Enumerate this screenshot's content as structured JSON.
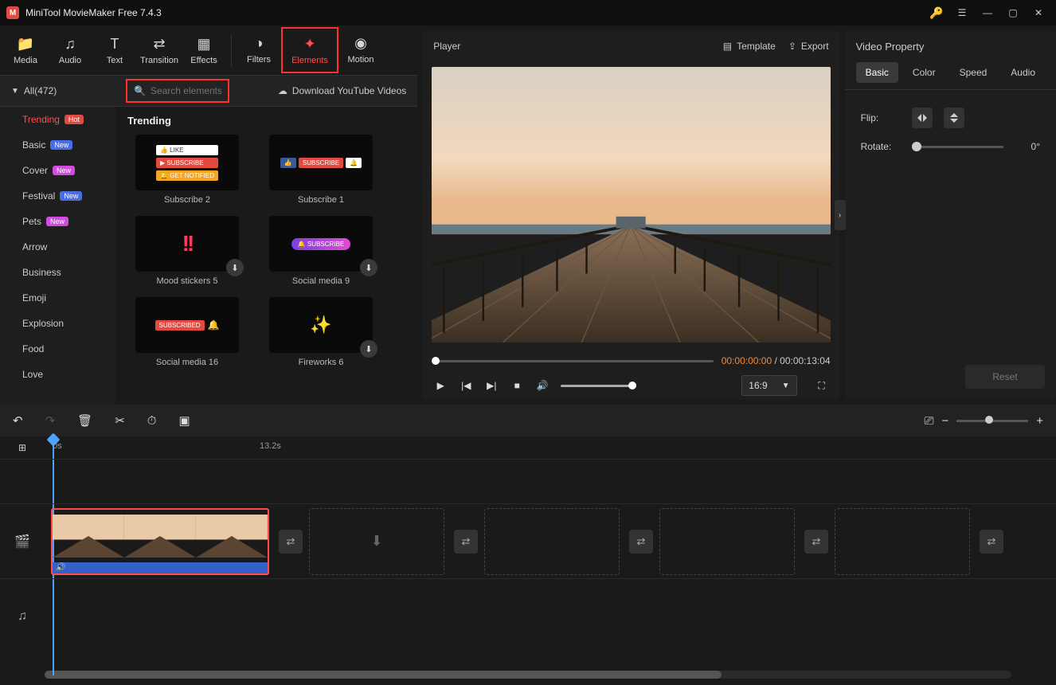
{
  "app": {
    "title": "MiniTool MovieMaker Free 7.4.3"
  },
  "toolbar": {
    "tabs": [
      {
        "id": "media",
        "label": "Media",
        "icon": "📁"
      },
      {
        "id": "audio",
        "label": "Audio",
        "icon": "♫"
      },
      {
        "id": "text",
        "label": "Text",
        "icon": "T"
      },
      {
        "id": "transition",
        "label": "Transition",
        "icon": "⇄"
      },
      {
        "id": "effects",
        "label": "Effects",
        "icon": "▦"
      },
      {
        "id": "filters",
        "label": "Filters",
        "icon": "◑"
      },
      {
        "id": "elements",
        "label": "Elements",
        "icon": "✦"
      },
      {
        "id": "motion",
        "label": "Motion",
        "icon": "◉"
      }
    ],
    "active": "elements"
  },
  "sidebar": {
    "all_label": "All(472)",
    "search_placeholder": "Search elements",
    "download_yt": "Download YouTube Videos",
    "categories": [
      {
        "label": "Trending",
        "badge": "Hot",
        "badge_class": "badge-hot",
        "active": true
      },
      {
        "label": "Basic",
        "badge": "New",
        "badge_class": "badge-new"
      },
      {
        "label": "Cover",
        "badge": "New",
        "badge_class": "badge-pink"
      },
      {
        "label": "Festival",
        "badge": "New",
        "badge_class": "badge-new"
      },
      {
        "label": "Pets",
        "badge": "New",
        "badge_class": "badge-pink"
      },
      {
        "label": "Arrow"
      },
      {
        "label": "Business"
      },
      {
        "label": "Emoji"
      },
      {
        "label": "Explosion"
      },
      {
        "label": "Food"
      },
      {
        "label": "Love"
      }
    ]
  },
  "gallery": {
    "heading": "Trending",
    "items": [
      {
        "label": "Subscribe 2",
        "dl": false,
        "kind": "sub2"
      },
      {
        "label": "Subscribe 1",
        "dl": false,
        "kind": "sub1"
      },
      {
        "label": "Mood stickers 5",
        "dl": true,
        "kind": "mood"
      },
      {
        "label": "Social media 9",
        "dl": true,
        "kind": "social"
      },
      {
        "label": "Social media 16",
        "dl": false,
        "kind": "subscribed"
      },
      {
        "label": "Fireworks 6",
        "dl": true,
        "kind": "fireworks"
      }
    ]
  },
  "player": {
    "title": "Player",
    "template_btn": "Template",
    "export_btn": "Export",
    "time_current": "00:00:00:00",
    "time_sep": " / ",
    "time_total": "00:00:13:04",
    "aspect": "16:9"
  },
  "property": {
    "title": "Video Property",
    "tabs": [
      "Basic",
      "Color",
      "Speed",
      "Audio"
    ],
    "active_tab": "Basic",
    "flip_label": "Flip:",
    "rotate_label": "Rotate:",
    "rotate_value": "0°",
    "reset": "Reset"
  },
  "timeline": {
    "ruler": [
      {
        "pos": 10,
        "label": "0s"
      },
      {
        "pos": 270,
        "label": "13.2s"
      }
    ]
  }
}
